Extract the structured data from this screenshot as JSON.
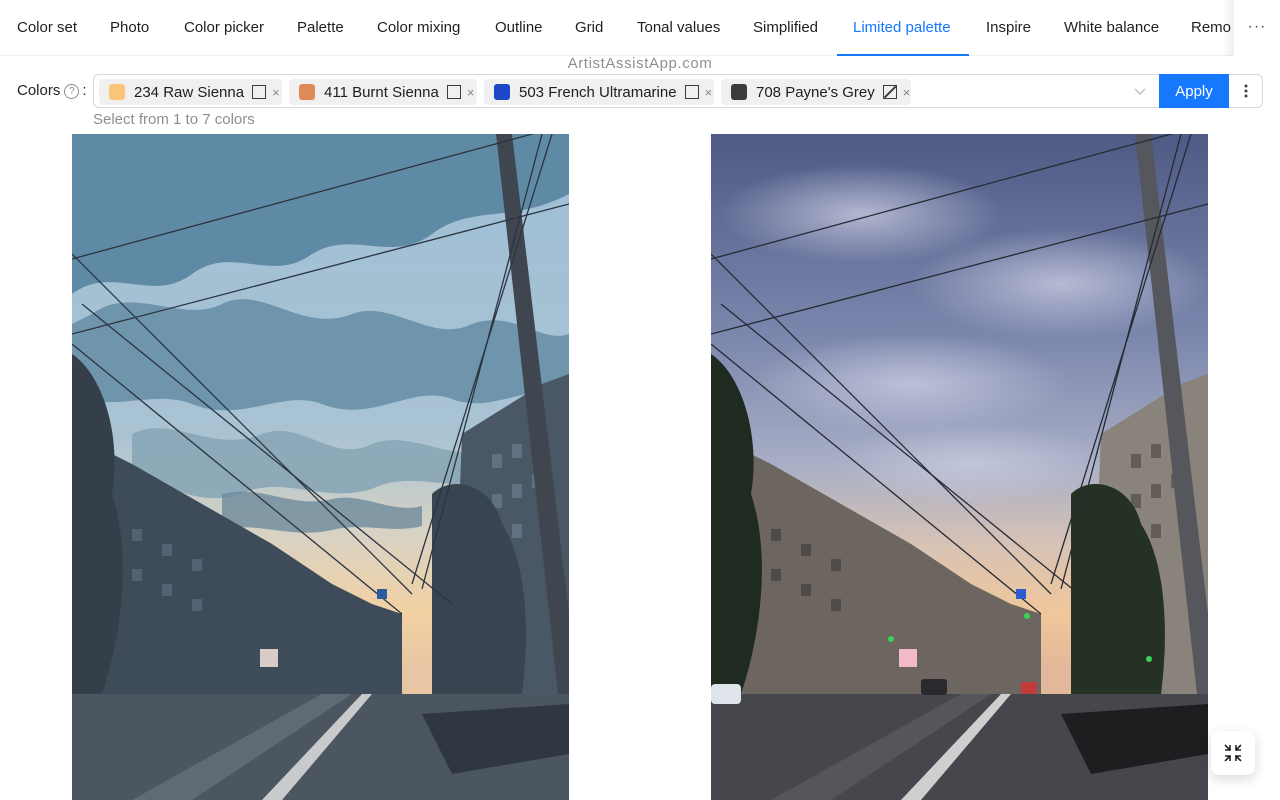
{
  "tabs": {
    "items": [
      {
        "label": "Color set"
      },
      {
        "label": "Photo"
      },
      {
        "label": "Color picker"
      },
      {
        "label": "Palette"
      },
      {
        "label": "Color mixing"
      },
      {
        "label": "Outline"
      },
      {
        "label": "Grid"
      },
      {
        "label": "Tonal values"
      },
      {
        "label": "Simplified"
      },
      {
        "label": "Limited palette"
      },
      {
        "label": "Inspire"
      },
      {
        "label": "White balance"
      },
      {
        "label": "Remo"
      }
    ],
    "active": "Limited palette",
    "more_label": "···",
    "more_icon": "ellipsis-icon"
  },
  "watermark": "ArtistAssistApp.com",
  "colors_field": {
    "label": "Colors",
    "help_icon": "question-circle-icon",
    "help_glyph": "?",
    "colon": ":",
    "helper_text": "Select from 1 to 7 colors",
    "tags": [
      {
        "label": "234 Raw Sienna",
        "color": "#f9c57a",
        "opacity_icon": "square-icon",
        "close": "×"
      },
      {
        "label": "411 Burnt Sienna",
        "color": "#e08a57",
        "opacity_icon": "square-icon",
        "close": "×"
      },
      {
        "label": "503 French Ultramarine",
        "color": "#1f45c8",
        "opacity_icon": "square-icon",
        "close": "×"
      },
      {
        "label": "708 Payne's Grey",
        "color": "#3b3b3b",
        "opacity_icon": "square-slash-icon",
        "close": "×"
      }
    ],
    "dropdown_icon": "chevron-down-icon"
  },
  "toolbar": {
    "apply_label": "Apply",
    "menu_icon": "vertical-ellipsis-icon"
  },
  "images": {
    "left": "limited-palette-preview",
    "right": "original-photo"
  },
  "fullscreen_icon": "fullscreen-exit-icon",
  "accent_color": "#1677ff"
}
